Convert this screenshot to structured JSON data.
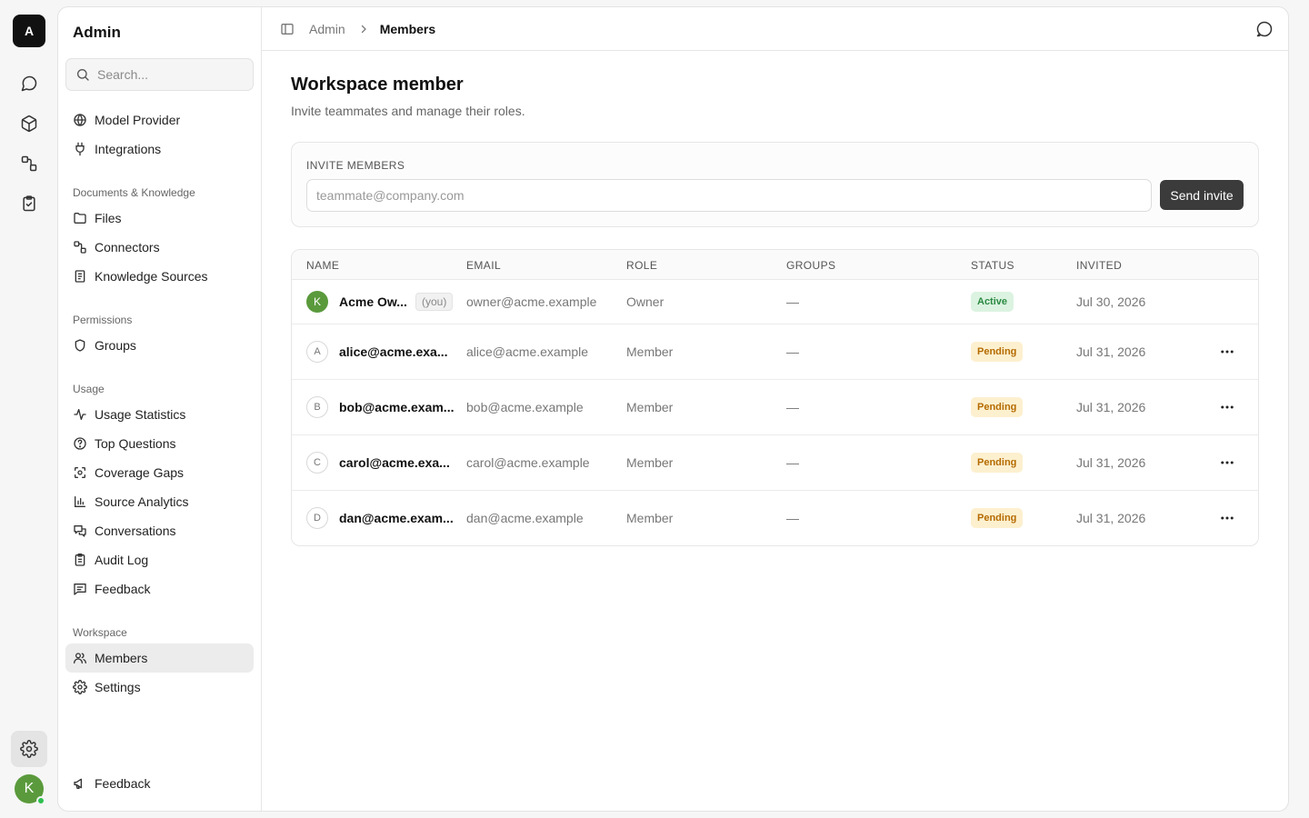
{
  "rail": {
    "logo": "A",
    "avatar_initial": "K"
  },
  "sidebar": {
    "title": "Admin",
    "search_placeholder": "Search...",
    "top_items": [
      {
        "label": "Model Provider",
        "icon": "globe-icon"
      },
      {
        "label": "Integrations",
        "icon": "plug-icon"
      }
    ],
    "sections": [
      {
        "title": "Documents & Knowledge",
        "items": [
          {
            "label": "Files",
            "icon": "folder-icon"
          },
          {
            "label": "Connectors",
            "icon": "connectors-icon"
          },
          {
            "label": "Knowledge Sources",
            "icon": "book-icon"
          }
        ]
      },
      {
        "title": "Permissions",
        "items": [
          {
            "label": "Groups",
            "icon": "shield-icon"
          }
        ]
      },
      {
        "title": "Usage",
        "items": [
          {
            "label": "Usage Statistics",
            "icon": "activity-icon"
          },
          {
            "label": "Top Questions",
            "icon": "help-circle-icon"
          },
          {
            "label": "Coverage Gaps",
            "icon": "scan-icon"
          },
          {
            "label": "Source Analytics",
            "icon": "bar-chart-icon"
          },
          {
            "label": "Conversations",
            "icon": "chat-icon"
          },
          {
            "label": "Audit Log",
            "icon": "clipboard-icon"
          },
          {
            "label": "Feedback",
            "icon": "message-square-icon"
          }
        ]
      },
      {
        "title": "Workspace",
        "items": [
          {
            "label": "Members",
            "icon": "users-icon",
            "active": true
          },
          {
            "label": "Settings",
            "icon": "gear-icon"
          }
        ]
      }
    ],
    "footer_item": {
      "label": "Feedback",
      "icon": "megaphone-icon"
    }
  },
  "topbar": {
    "crumb_parent": "Admin",
    "crumb_current": "Members"
  },
  "page": {
    "title": "Workspace member",
    "subtitle": "Invite teammates and manage their roles."
  },
  "invite": {
    "label": "INVITE MEMBERS",
    "placeholder": "teammate@company.com",
    "button": "Send invite"
  },
  "table": {
    "columns": [
      "NAME",
      "EMAIL",
      "ROLE",
      "GROUPS",
      "STATUS",
      "INVITED"
    ],
    "rows": [
      {
        "initial": "K",
        "name": "Acme Ow...",
        "you": "(you)",
        "email": "owner@acme.example",
        "role": "Owner",
        "groups": "—",
        "status": "Active",
        "invited": "Jul 30, 2026"
      },
      {
        "initial": "A",
        "name": "alice@acme.exa...",
        "email": "alice@acme.example",
        "role": "Member",
        "groups": "—",
        "status": "Pending",
        "invited": "Jul 31, 2026"
      },
      {
        "initial": "B",
        "name": "bob@acme.exam...",
        "email": "bob@acme.example",
        "role": "Member",
        "groups": "—",
        "status": "Pending",
        "invited": "Jul 31, 2026"
      },
      {
        "initial": "C",
        "name": "carol@acme.exa...",
        "email": "carol@acme.example",
        "role": "Member",
        "groups": "—",
        "status": "Pending",
        "invited": "Jul 31, 2026"
      },
      {
        "initial": "D",
        "name": "dan@acme.exam...",
        "email": "dan@acme.example",
        "role": "Member",
        "groups": "—",
        "status": "Pending",
        "invited": "Jul 31, 2026"
      }
    ]
  },
  "colors": {
    "active_badge": "#2b8a42",
    "pending_badge": "#b56b00",
    "primary_button": "#3b3b3b",
    "owner_avatar": "#5a9a3c"
  }
}
